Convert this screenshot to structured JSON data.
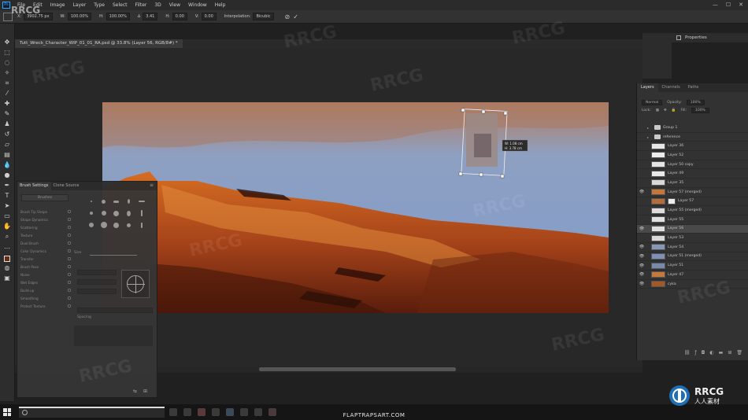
{
  "app": {
    "logo": "Ps"
  },
  "menu": [
    "File",
    "Edit",
    "Image",
    "Layer",
    "Type",
    "Select",
    "Filter",
    "3D",
    "View",
    "Window",
    "Help"
  ],
  "options_bar": {
    "x_label": "X:",
    "x_value": "3902.75 px",
    "w_label": "W:",
    "w_value": "100.00%",
    "h_label": "H:",
    "h_value": "100.00%",
    "angle_label": "∆",
    "angle_value": "3.41",
    "hskew_label": "H:",
    "hskew_value": "0.00",
    "vskew_label": "V:",
    "vskew_value": "0.00",
    "interp_label": "Interpolation:",
    "interp_value": "Bicubic",
    "cancel_symbol": "⊘",
    "commit_symbol": "✓"
  },
  "document": {
    "tab_title": "Tutt_Wreck_Character_WIP_01_01_RA.psd @ 33.8% (Layer 56, RGB/8#) *"
  },
  "transform_readout": {
    "w": "W:  1.08 cm",
    "h": "H:  3.78 cm"
  },
  "brush_settings": {
    "tabs": [
      "Brush Settings",
      "Clone Source"
    ],
    "brushes_button": "Brushes",
    "options": [
      "Brush Tip Shape",
      "Shape Dynamics",
      "Scattering",
      "Texture",
      "Dual Brush",
      "Color Dynamics",
      "Transfer",
      "Brush Pose",
      "Noise",
      "Wet Edges",
      "Build-up",
      "Smoothing",
      "Protect Texture"
    ],
    "size_label": "Size",
    "spacing_label": "Spacing"
  },
  "properties": {
    "title": "Properties"
  },
  "layers_panel": {
    "tabs": [
      "Layers",
      "Channels",
      "Paths"
    ],
    "blend_mode": "Normal",
    "opacity_label": "Opacity:",
    "opacity_value": "100%",
    "lock_label": "Lock:",
    "fill_label": "Fill:",
    "fill_value": "100%",
    "layers": [
      {
        "name": "Group 1",
        "type": "group",
        "visible": false,
        "thumb": "#cfcfcf"
      },
      {
        "name": "reference",
        "type": "group",
        "visible": false,
        "thumb": "#cfcfcf"
      },
      {
        "name": "Layer 36",
        "type": "layer",
        "visible": false,
        "thumb": "#e8e8e8"
      },
      {
        "name": "Layer 52",
        "type": "layer",
        "visible": false,
        "thumb": "#ededed"
      },
      {
        "name": "Layer 50 copy",
        "type": "layer",
        "visible": false,
        "thumb": "#e4e4e4"
      },
      {
        "name": "Layer 49",
        "type": "layer",
        "visible": false,
        "thumb": "#e9e9e9"
      },
      {
        "name": "Layer 35",
        "type": "layer",
        "visible": false,
        "thumb": "#d8d8d8"
      },
      {
        "name": "Layer 57 (merged)",
        "type": "layer",
        "visible": true,
        "thumb": "#c87636"
      },
      {
        "name": "Layer 57",
        "type": "layer",
        "visible": false,
        "thumb": "#b56b3a",
        "mask": true
      },
      {
        "name": "Layer 55 (merged)",
        "type": "layer",
        "visible": false,
        "thumb": "#ddd"
      },
      {
        "name": "Layer 55",
        "type": "layer",
        "visible": false,
        "thumb": "#e2e2e2"
      },
      {
        "name": "Layer 56",
        "type": "layer",
        "visible": true,
        "selected": true,
        "thumb": "#e0e0e0"
      },
      {
        "name": "Layer 53",
        "type": "layer",
        "visible": false,
        "thumb": "#d9d9d9"
      },
      {
        "name": "Layer 54",
        "type": "layer",
        "visible": true,
        "thumb": "#8897b8"
      },
      {
        "name": "Layer 51 (merged)",
        "type": "layer",
        "visible": true,
        "thumb": "#7f8fb5"
      },
      {
        "name": "Layer 51",
        "type": "layer",
        "visible": true,
        "thumb": "#7989ae"
      },
      {
        "name": "Layer 47",
        "type": "layer",
        "visible": true,
        "thumb": "#c47a3c"
      },
      {
        "name": "cyka",
        "type": "layer",
        "visible": true,
        "thumb": "#a3582a"
      }
    ],
    "footer_icons": [
      "link-icon",
      "fx-icon",
      "mask-icon",
      "adjustment-icon",
      "folder-icon",
      "new-layer-icon",
      "trash-icon"
    ]
  },
  "watermark": {
    "text": "RRCG",
    "cn": "人人素材"
  },
  "credit": "FLAPTRAPSART.COM",
  "colors": {
    "accent": "#31a8ff",
    "foreground": "#6a2c13",
    "sky": "#7f9bc8",
    "rock": "#c5612a"
  }
}
